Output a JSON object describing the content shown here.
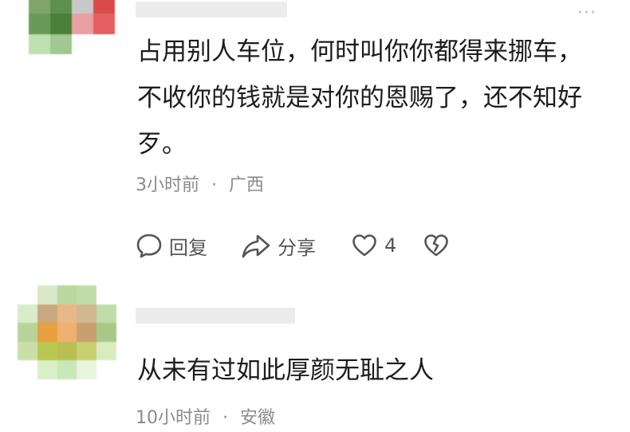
{
  "comments": [
    {
      "text": "占用别人车位，何时叫你你都得来挪车，不收你的钱就是对你的恩赐了，还不知好歹。",
      "time": "3小时前",
      "location": "广西",
      "actions": {
        "reply_label": "回复",
        "share_label": "分享",
        "like_count": "4"
      }
    },
    {
      "text": "从未有过如此厚颜无耻之人",
      "time": "10小时前",
      "location": "安徽"
    }
  ],
  "more_glyph": "···",
  "meta_separator": "·",
  "colors": {
    "text": "#1d1d1d",
    "meta": "#8a8a8a",
    "icon": "#555555",
    "avatar1": [
      "#7fa56a",
      "#5f8f4f",
      "#c8c8c8",
      "#d94b4b",
      "#6a9a5a",
      "#4a7f3a",
      "#e8a0a0",
      "#e56060",
      "#bfe0b0",
      "#a0c890",
      "#ffffff",
      "#ffffff"
    ],
    "avatar2": [
      "#ffffff",
      "#d8e8c8",
      "#b8d8a0",
      "#c0dca8",
      "#ffffff",
      "#d8ecc8",
      "#c8a880",
      "#e8b888",
      "#d0b890",
      "#c0dcaa",
      "#b8d49a",
      "#e8a040",
      "#f0b070",
      "#c8a070",
      "#a8c888",
      "#c8e0a8",
      "#b8c850",
      "#b8c050",
      "#c8d070",
      "#d8ecc0",
      "#ffffff",
      "#d8f0c8",
      "#c8e8b8",
      "#e8f4e0",
      "#ffffff"
    ]
  }
}
